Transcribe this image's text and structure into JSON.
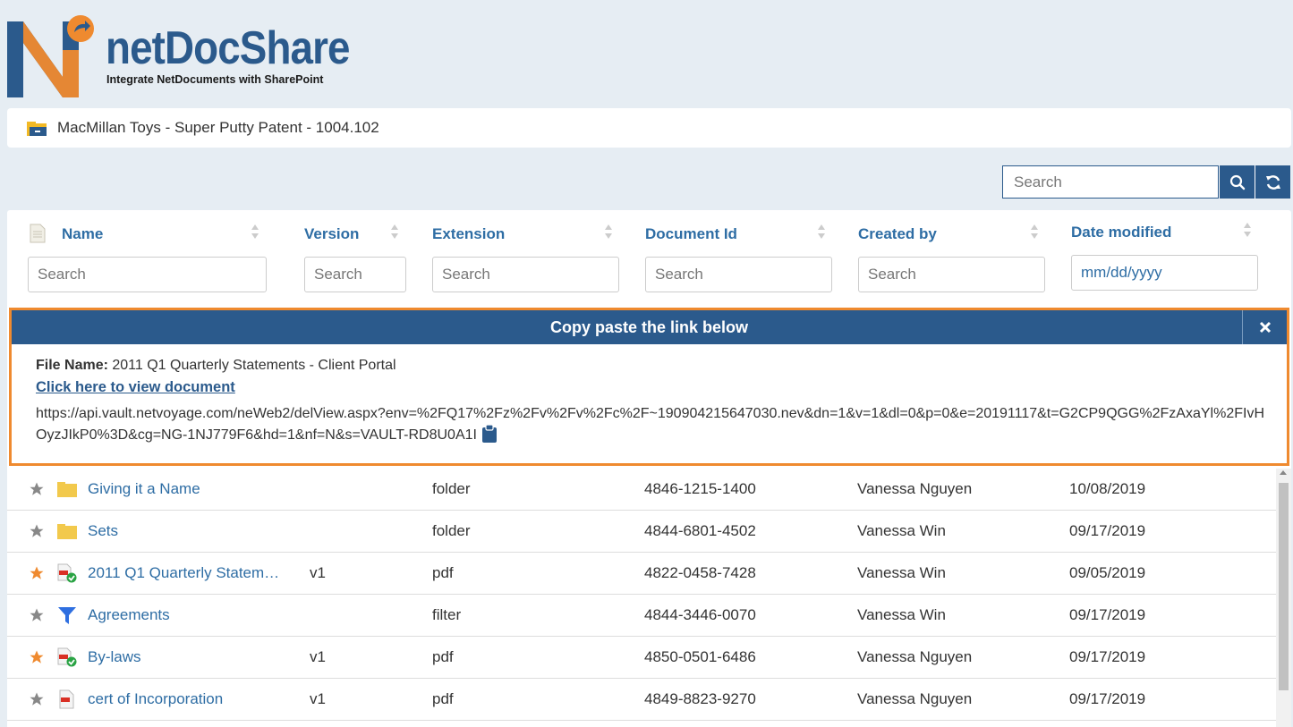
{
  "brand": {
    "name": "netDocShare",
    "tagline": "Integrate NetDocuments with SharePoint",
    "colors": {
      "primary": "#2b5a8c",
      "accent": "#ef8a2f"
    }
  },
  "breadcrumb": {
    "icon": "folder-icon",
    "text": "MacMillan Toys - Super Putty Patent - 1004.102"
  },
  "top_search": {
    "placeholder": "Search",
    "search_icon": "search-icon",
    "refresh_icon": "refresh-icon"
  },
  "columns": [
    {
      "label": "Name",
      "filter_placeholder": "Search"
    },
    {
      "label": "Version",
      "filter_placeholder": "Search"
    },
    {
      "label": "Extension",
      "filter_placeholder": "Search"
    },
    {
      "label": "Document Id",
      "filter_placeholder": "Search"
    },
    {
      "label": "Created by",
      "filter_placeholder": "Search"
    },
    {
      "label": "Date modified",
      "filter_placeholder": "mm/dd/yyyy"
    }
  ],
  "dialog": {
    "title": "Copy paste the link below",
    "file_name_label": "File Name:",
    "file_name": "2011 Q1 Quarterly Statements - Client Portal",
    "view_link": "Click here to view document",
    "url": "https://api.vault.netvoyage.com/neWeb2/delView.aspx?env=%2FQ17%2Fz%2Fv%2Fv%2Fc%2F~190904215647030.nev&dn=1&v=1&dl=0&p=0&e=20191117&t=G2CP9QGG%2FzAxaYl%2FIvHOyzJIkP0%3D&cg=NG-1NJ779F6&hd=1&nf=N&s=VAULT-RD8U0A1I",
    "close_icon": "close-icon",
    "clipboard_icon": "clipboard-icon"
  },
  "rows": [
    {
      "starred": false,
      "icon": "folder-icon",
      "name": "Giving it a Name",
      "version": "",
      "extension": "folder",
      "doc_id": "4846-1215-1400",
      "created_by": "Vanessa Nguyen",
      "modified": "10/08/2019"
    },
    {
      "starred": false,
      "icon": "folder-icon",
      "name": "Sets",
      "version": "",
      "extension": "folder",
      "doc_id": "4844-6801-4502",
      "created_by": "Vanessa Win",
      "modified": "09/17/2019"
    },
    {
      "starred": true,
      "icon": "pdf-shared-icon",
      "name": "2011 Q1 Quarterly Statem…",
      "version": "v1",
      "extension": "pdf",
      "doc_id": "4822-0458-7428",
      "created_by": "Vanessa Win",
      "modified": "09/05/2019"
    },
    {
      "starred": false,
      "icon": "filter-icon",
      "name": "Agreements",
      "version": "",
      "extension": "filter",
      "doc_id": "4844-3446-0070",
      "created_by": "Vanessa Win",
      "modified": "09/17/2019"
    },
    {
      "starred": true,
      "icon": "pdf-shared-icon",
      "name": "By-laws",
      "version": "v1",
      "extension": "pdf",
      "doc_id": "4850-0501-6486",
      "created_by": "Vanessa Nguyen",
      "modified": "09/17/2019"
    },
    {
      "starred": false,
      "icon": "pdf-icon",
      "name": "cert of Incorporation",
      "version": "v1",
      "extension": "pdf",
      "doc_id": "4849-8823-9270",
      "created_by": "Vanessa Nguyen",
      "modified": "09/17/2019"
    }
  ]
}
